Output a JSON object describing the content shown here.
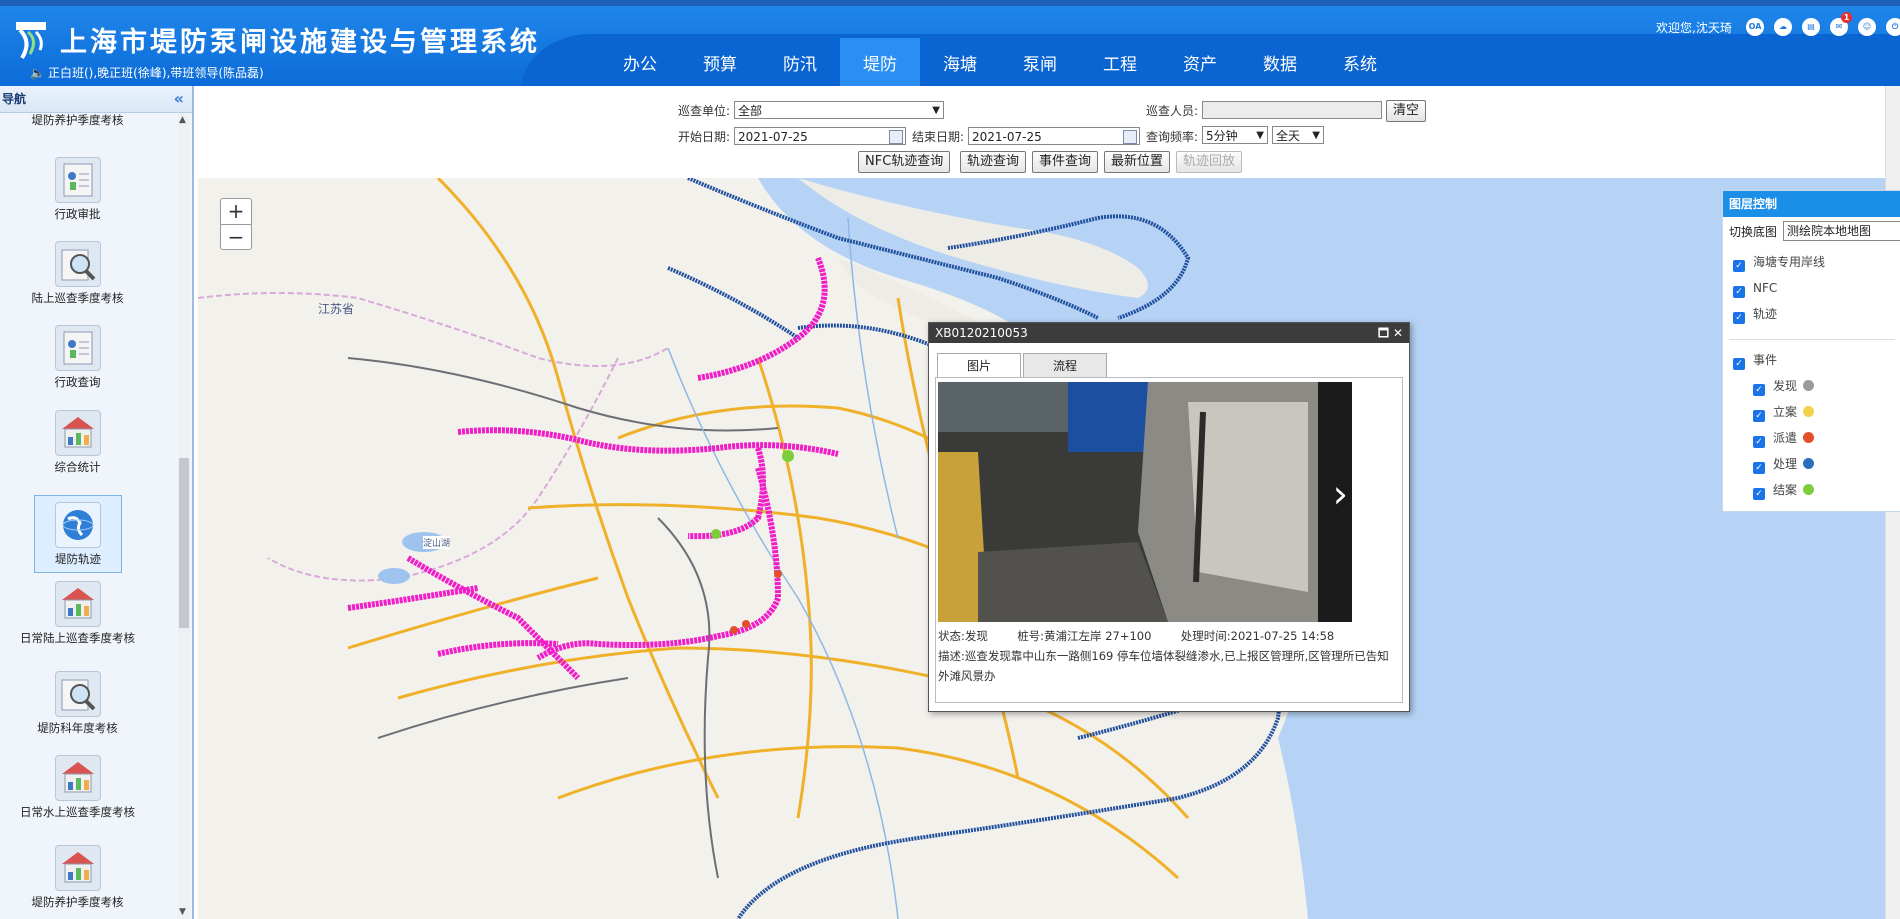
{
  "header": {
    "title": "上海市堤防泵闸设施建设与管理系统",
    "notice": "正白班(),晚正班(徐峰),带班领导(陈品磊)",
    "welcome": "欢迎您,沈天琦",
    "icons": [
      {
        "name": "oa-icon",
        "text": "OA"
      },
      {
        "name": "cloud-icon",
        "text": ""
      },
      {
        "name": "doc-icon",
        "text": ""
      },
      {
        "name": "message-icon",
        "text": "",
        "badge": "1"
      },
      {
        "name": "user-icon",
        "text": ""
      },
      {
        "name": "logout-icon",
        "text": ""
      }
    ],
    "nav": [
      "办公",
      "预算",
      "防汛",
      "堤防",
      "海塘",
      "泵闸",
      "工程",
      "资产",
      "数据",
      "系统"
    ],
    "active_nav": "堤防"
  },
  "sidebar": {
    "title": "导航",
    "collapse": "«",
    "items": [
      {
        "label": "堤防养护季度考核",
        "icon": "none"
      },
      {
        "label": "行政审批",
        "icon": "approval-icon"
      },
      {
        "label": "陆上巡查季度考核",
        "icon": "search-check-icon"
      },
      {
        "label": "行政查询",
        "icon": "approval-icon"
      },
      {
        "label": "综合统计",
        "icon": "statistics-icon"
      },
      {
        "label": "堤防轨迹",
        "icon": "globe-icon",
        "active": true
      },
      {
        "label": "日常陆上巡查季度考核",
        "icon": "statistics-icon"
      },
      {
        "label": "堤防科年度考核",
        "icon": "search-check-icon"
      },
      {
        "label": "日常水上巡查季度考核",
        "icon": "statistics-icon"
      },
      {
        "label": "堤防养护季度考核",
        "icon": "statistics-icon"
      }
    ]
  },
  "filters": {
    "unit_label": "巡查单位:",
    "unit_value": "全部",
    "person_label": "巡查人员:",
    "person_value": "",
    "clear_button": "清空",
    "start_label": "开始日期:",
    "start_value": "2021-07-25",
    "end_label": "结束日期:",
    "end_value": "2021-07-25",
    "freq_label": "查询频率:",
    "freq_value": "5分钟",
    "range_value": "全天",
    "buttons": [
      "NFC轨迹查询",
      "轨迹查询",
      "事件查询",
      "最新位置",
      "轨迹回放"
    ]
  },
  "map": {
    "zoom_in": "+",
    "zoom_out": "−",
    "labels": [
      "江苏省",
      "淀山湖"
    ]
  },
  "popup": {
    "title": "XB0120210053",
    "tabs": [
      "图片",
      "流程"
    ],
    "status": "状态:发现",
    "pile": "桩号:黄浦江左岸 27+100",
    "time": "处理时间:2021-07-25 14:58",
    "description": "描述:巡查发现靠中山东一路侧169 停车位墙体裂缝渗水,已上报区管理所,区管理所已告知外滩风景办"
  },
  "layers": {
    "title": "图层控制",
    "base_label": "切换底图",
    "base_value": "测绘院本地地图",
    "items": [
      {
        "label": "海塘专用岸线",
        "checked": true
      },
      {
        "label": "NFC",
        "checked": true
      },
      {
        "label": "轨迹",
        "checked": true
      },
      {
        "label": "事件",
        "checked": true
      }
    ],
    "events": [
      {
        "label": "发现",
        "color": "#9a9a9a"
      },
      {
        "label": "立案",
        "color": "#f1d24a"
      },
      {
        "label": "派遣",
        "color": "#e2502b"
      },
      {
        "label": "处理",
        "color": "#2b6fb8"
      },
      {
        "label": "结案",
        "color": "#7ccf3a"
      }
    ]
  }
}
